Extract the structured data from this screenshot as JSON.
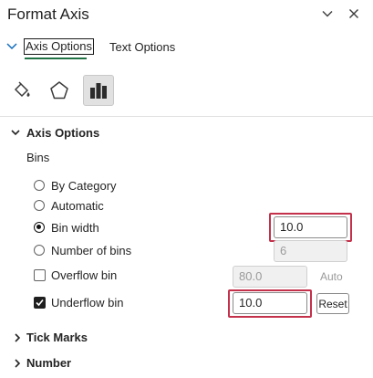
{
  "header": {
    "title": "Format Axis",
    "dropdown_icon": "chevron-down-icon",
    "close_icon": "close-icon"
  },
  "tabs": [
    {
      "label": "Axis Options",
      "active": true
    },
    {
      "label": "Text Options",
      "active": false
    }
  ],
  "category_icons": [
    "fill-line-icon",
    "effects-pentagon-icon",
    "axis-options-bars-icon"
  ],
  "axis_options": {
    "section_title": "Axis Options",
    "bins_label": "Bins",
    "by_category": "By Category",
    "automatic": "Automatic",
    "bin_width": {
      "label": "Bin width",
      "value": "10.0",
      "selected": true
    },
    "number_of_bins": {
      "label": "Number of bins",
      "value": "6"
    },
    "overflow_bin": {
      "label": "Overflow bin",
      "value": "80.0",
      "checked": false,
      "auto_label": "Auto"
    },
    "underflow_bin": {
      "label": "Underflow bin",
      "value": "10.0",
      "checked": true,
      "reset_label": "Reset"
    }
  },
  "collapsed_sections": [
    "Tick Marks",
    "Number"
  ],
  "colors": {
    "accent_underline": "#217346",
    "highlight": "#c4314b",
    "tab_chevron": "#0f6cbd"
  }
}
